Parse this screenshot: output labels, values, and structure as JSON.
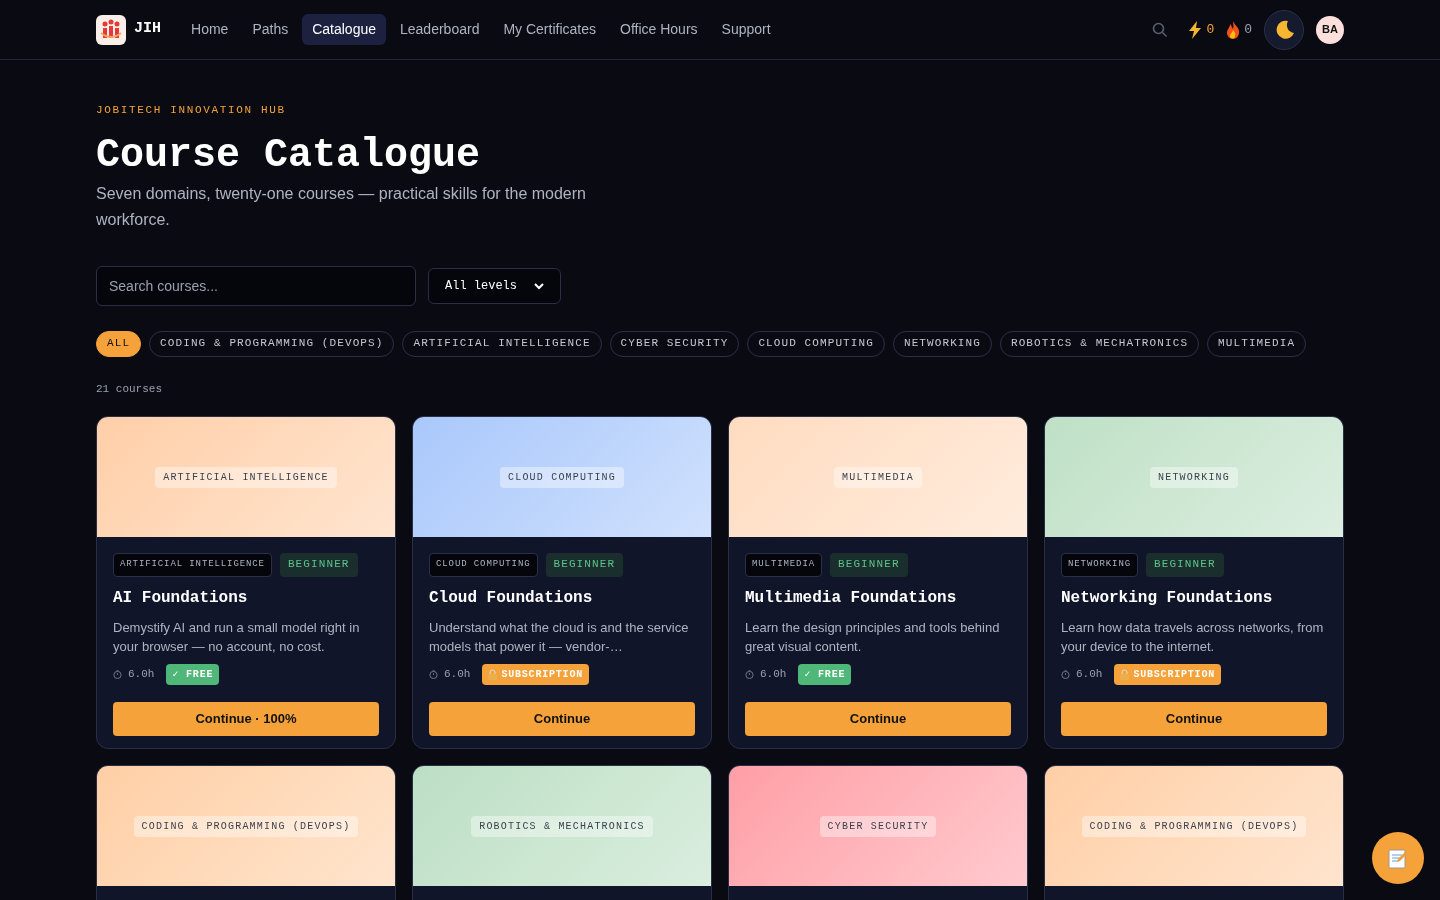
{
  "nav": {
    "brand": "JIH",
    "links": [
      {
        "label": "Home",
        "selected": false
      },
      {
        "label": "Paths",
        "selected": false
      },
      {
        "label": "Catalogue",
        "selected": true
      },
      {
        "label": "Leaderboard",
        "selected": false
      },
      {
        "label": "My Certificates",
        "selected": false
      },
      {
        "label": "Office Hours",
        "selected": false
      },
      {
        "label": "Support",
        "selected": false
      }
    ],
    "xp": "0",
    "streak": "0",
    "avatar": "BA"
  },
  "header": {
    "eyebrow": "JOBITECH INNOVATION HUB",
    "title": "Course Catalogue",
    "subtitle": "Seven domains, twenty-one courses — practical skills for the modern workforce."
  },
  "filters": {
    "search_placeholder": "Search courses...",
    "level": "All levels",
    "chips": [
      {
        "label": "ALL",
        "selected": true
      },
      {
        "label": "CODING & PROGRAMMING (DEVOPS)",
        "selected": false
      },
      {
        "label": "ARTIFICIAL INTELLIGENCE",
        "selected": false
      },
      {
        "label": "CYBER SECURITY",
        "selected": false
      },
      {
        "label": "CLOUD COMPUTING",
        "selected": false
      },
      {
        "label": "NETWORKING",
        "selected": false
      },
      {
        "label": "ROBOTICS & MECHATRONICS",
        "selected": false
      },
      {
        "label": "MULTIMEDIA",
        "selected": false
      }
    ]
  },
  "count": "21 courses",
  "courses": [
    {
      "banner": "ARTIFICIAL INTELLIGENCE",
      "color": "#ffcfa8",
      "category": "ARTIFICIAL INTELLIGENCE",
      "level": "BEGINNER",
      "title": "AI Foundations",
      "description": "Demystify AI and run a small model right in your browser — no account, no cost.",
      "duration": "6.0h",
      "access": {
        "kind": "free",
        "label": "✓ FREE"
      },
      "button": "Continue · 100%"
    },
    {
      "banner": "CLOUD COMPUTING",
      "color": "#a9c8fb",
      "category": "CLOUD COMPUTING",
      "level": "BEGINNER",
      "title": "Cloud Foundations",
      "description": "Understand what the cloud is and the service models that power it — vendor-…",
      "duration": "6.0h",
      "access": {
        "kind": "subscription",
        "label": "SUBSCRIPTION"
      },
      "button": "Continue"
    },
    {
      "banner": "MULTIMEDIA",
      "color": "#ffdcc0",
      "category": "MULTIMEDIA",
      "level": "BEGINNER",
      "title": "Multimedia Foundations",
      "description": "Learn the design principles and tools behind great visual content.",
      "duration": "6.0h",
      "access": {
        "kind": "free",
        "label": "✓ FREE"
      },
      "button": "Continue"
    },
    {
      "banner": "NETWORKING",
      "color": "#bfe0c6",
      "category": "NETWORKING",
      "level": "BEGINNER",
      "title": "Networking Foundations",
      "description": "Learn how data travels across networks, from your device to the internet.",
      "duration": "6.0h",
      "access": {
        "kind": "subscription",
        "label": "SUBSCRIPTION"
      },
      "button": "Continue"
    },
    {
      "banner": "CODING & PROGRAMMING (DEVOPS)",
      "color": "#ffcfa5"
    },
    {
      "banner": "ROBOTICS & MECHATRONICS",
      "color": "#bcdfc4"
    },
    {
      "banner": "CYBER SECURITY",
      "color": "#ff9ea6"
    },
    {
      "banner": "CODING & PROGRAMMING (DEVOPS)",
      "color": "#ffcfa6"
    }
  ]
}
